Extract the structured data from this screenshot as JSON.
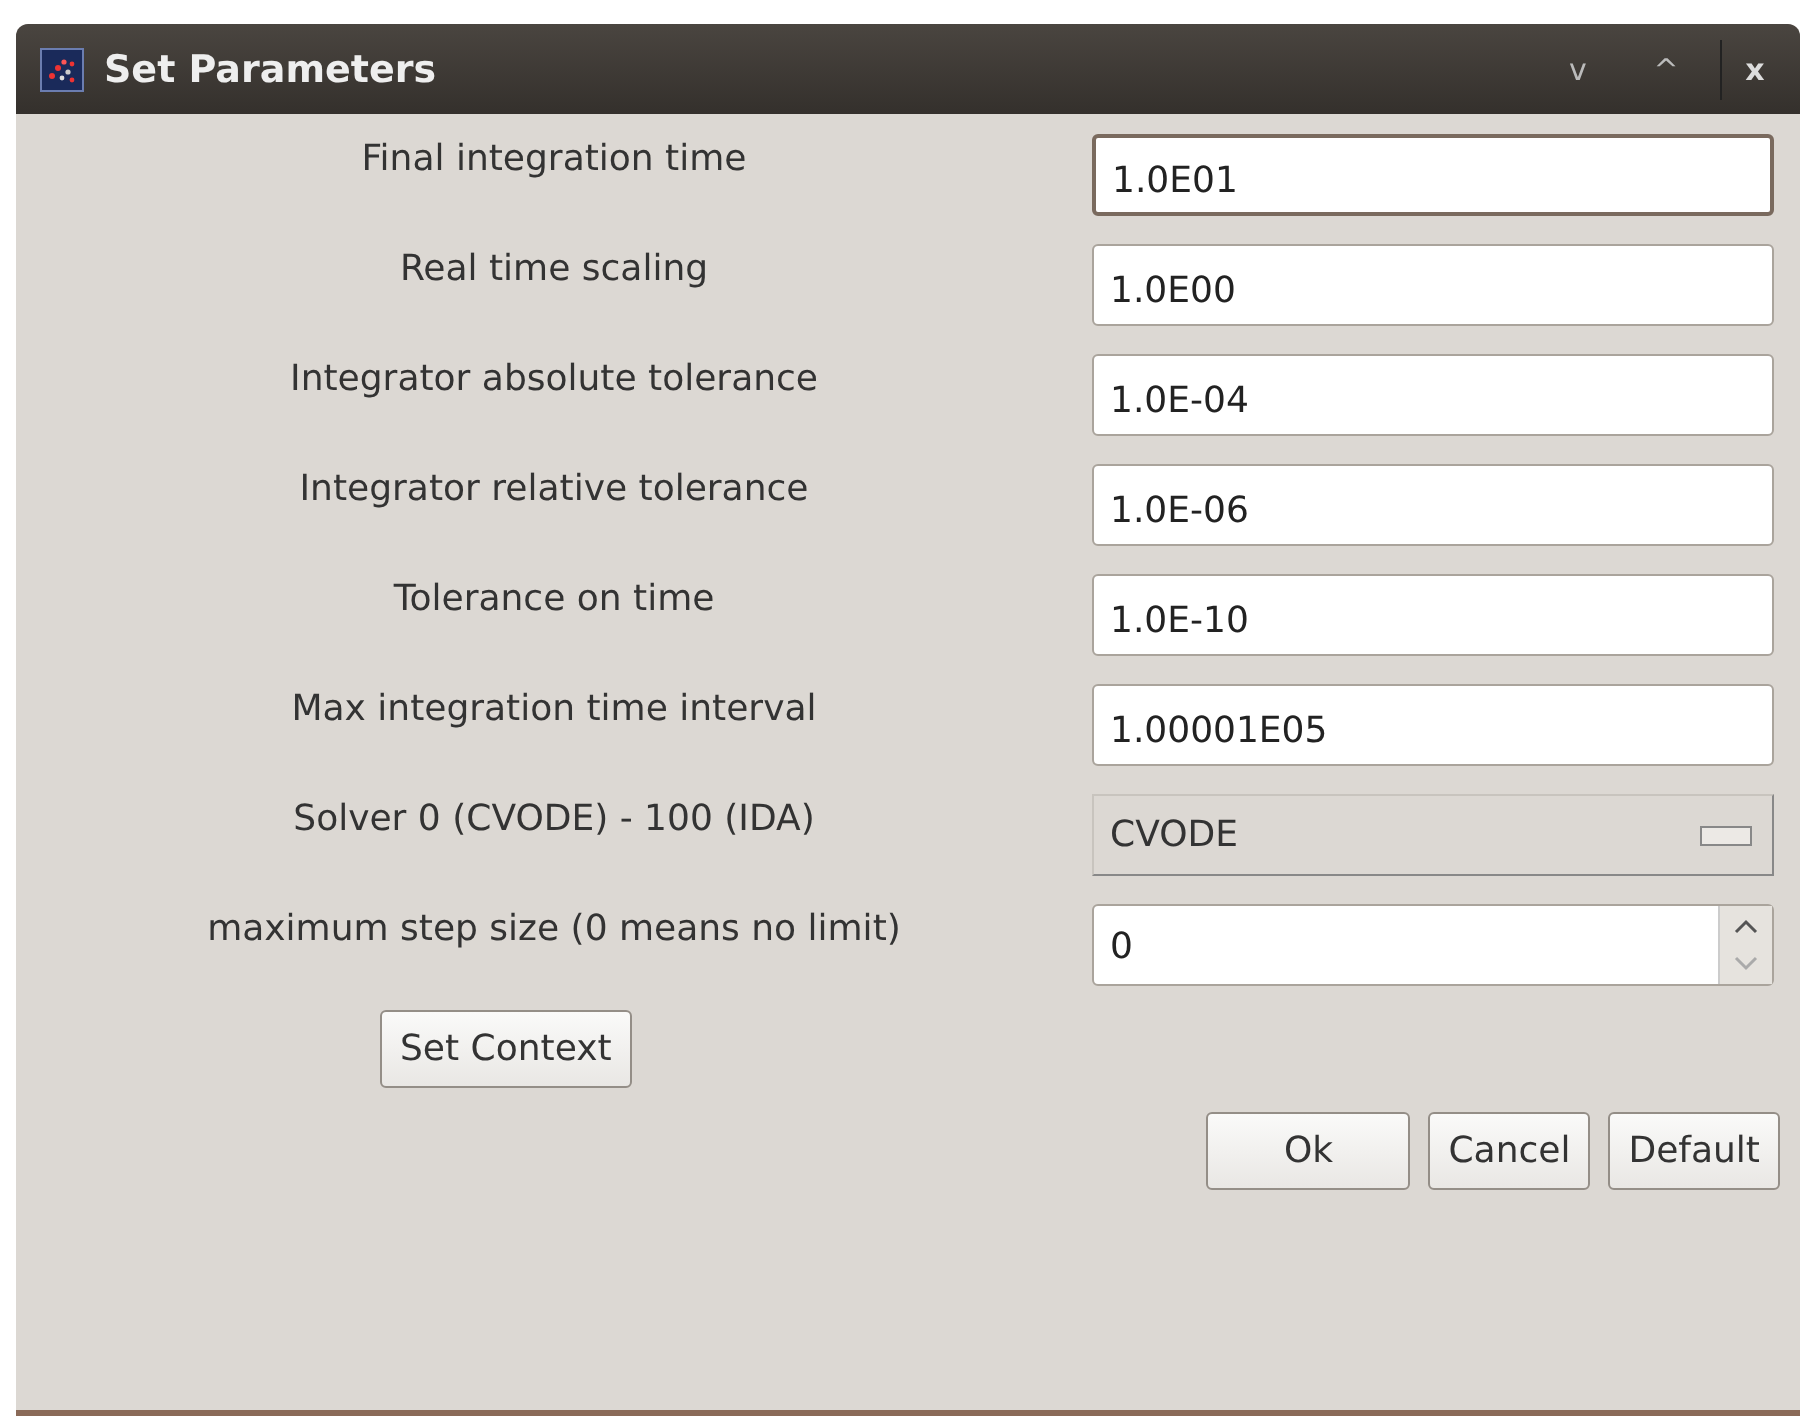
{
  "window": {
    "title": "Set Parameters",
    "controls": [
      "v",
      "^",
      "x"
    ]
  },
  "parameters": [
    {
      "label": "Final integration time",
      "kind": "text",
      "value": "1.0E01",
      "focused": true
    },
    {
      "label": "Real time scaling",
      "kind": "text",
      "value": "1.0E00",
      "focused": false
    },
    {
      "label": "Integrator absolute tolerance",
      "kind": "text",
      "value": "1.0E-04",
      "focused": false
    },
    {
      "label": "Integrator relative tolerance",
      "kind": "text",
      "value": "1.0E-06",
      "focused": false
    },
    {
      "label": "Tolerance on time",
      "kind": "text",
      "value": "1.0E-10",
      "focused": false
    },
    {
      "label": "Max integration time interval",
      "kind": "text",
      "value": "1.00001E05",
      "focused": false
    },
    {
      "label": "Solver 0 (CVODE) - 100 (IDA)",
      "kind": "dropdown",
      "value": "CVODE",
      "focused": false
    },
    {
      "label": "maximum step size (0 means no limit)",
      "kind": "spinner",
      "value": "0",
      "focused": false
    }
  ],
  "context_button": "Set Context",
  "buttons": [
    "Ok",
    "Cancel",
    "Default"
  ]
}
